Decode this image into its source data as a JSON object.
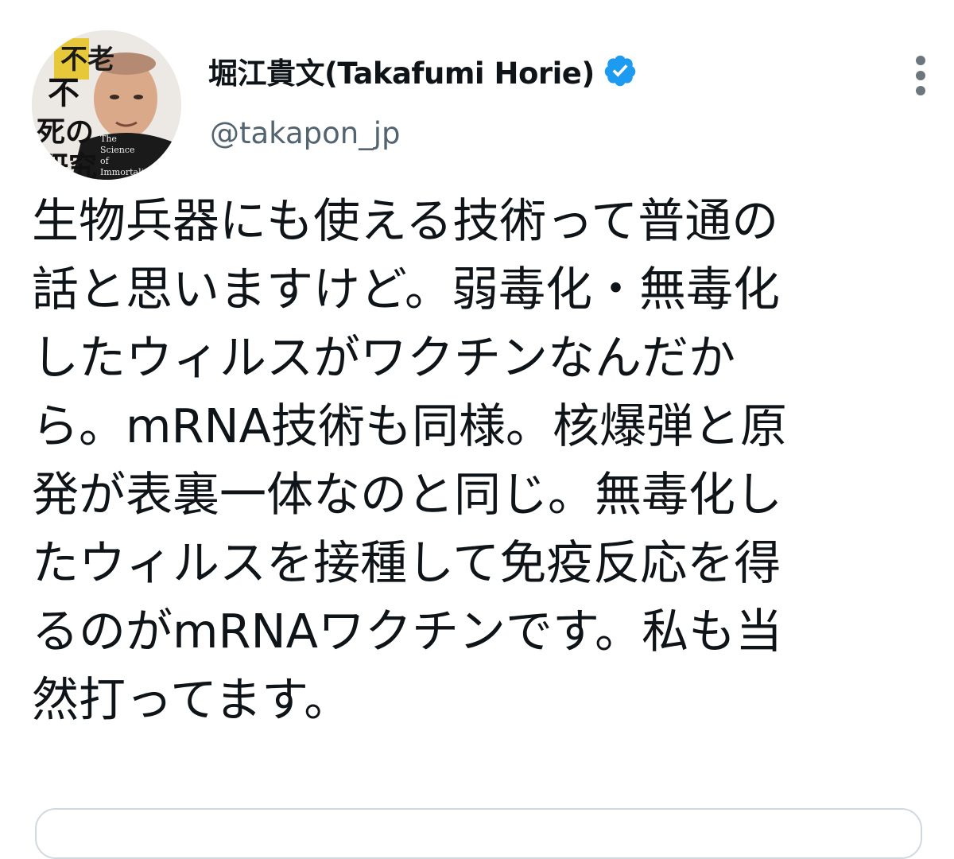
{
  "author": {
    "display_name": "堀江貴文(Takafumi Horie)",
    "handle": "@takapon_jp",
    "verified_icon": "verified-badge-icon"
  },
  "avatar": {
    "cover_text_jp_lines": [
      "不老",
      "不",
      "死の",
      "研究"
    ],
    "cover_text_en_lines": [
      "The",
      "Science",
      "of",
      "Immortality"
    ]
  },
  "tweet": {
    "lines": [
      "生物兵器にも使える技術って普通の",
      "話と思いますけど。弱毒化・無毒化",
      "したウィルスがワクチンなんだか",
      "ら。mRNA技術も同様。核爆弾と原",
      "発が表裏一体なのと同じ。無毒化し",
      "たウィルスを接種して免疫反応を得",
      "るのがmRNAワクチンです。私も当",
      "然打ってます。"
    ]
  },
  "colors": {
    "verified_blue": "#1d9bf0",
    "handle_gray": "#536471",
    "text": "#0f1419"
  }
}
